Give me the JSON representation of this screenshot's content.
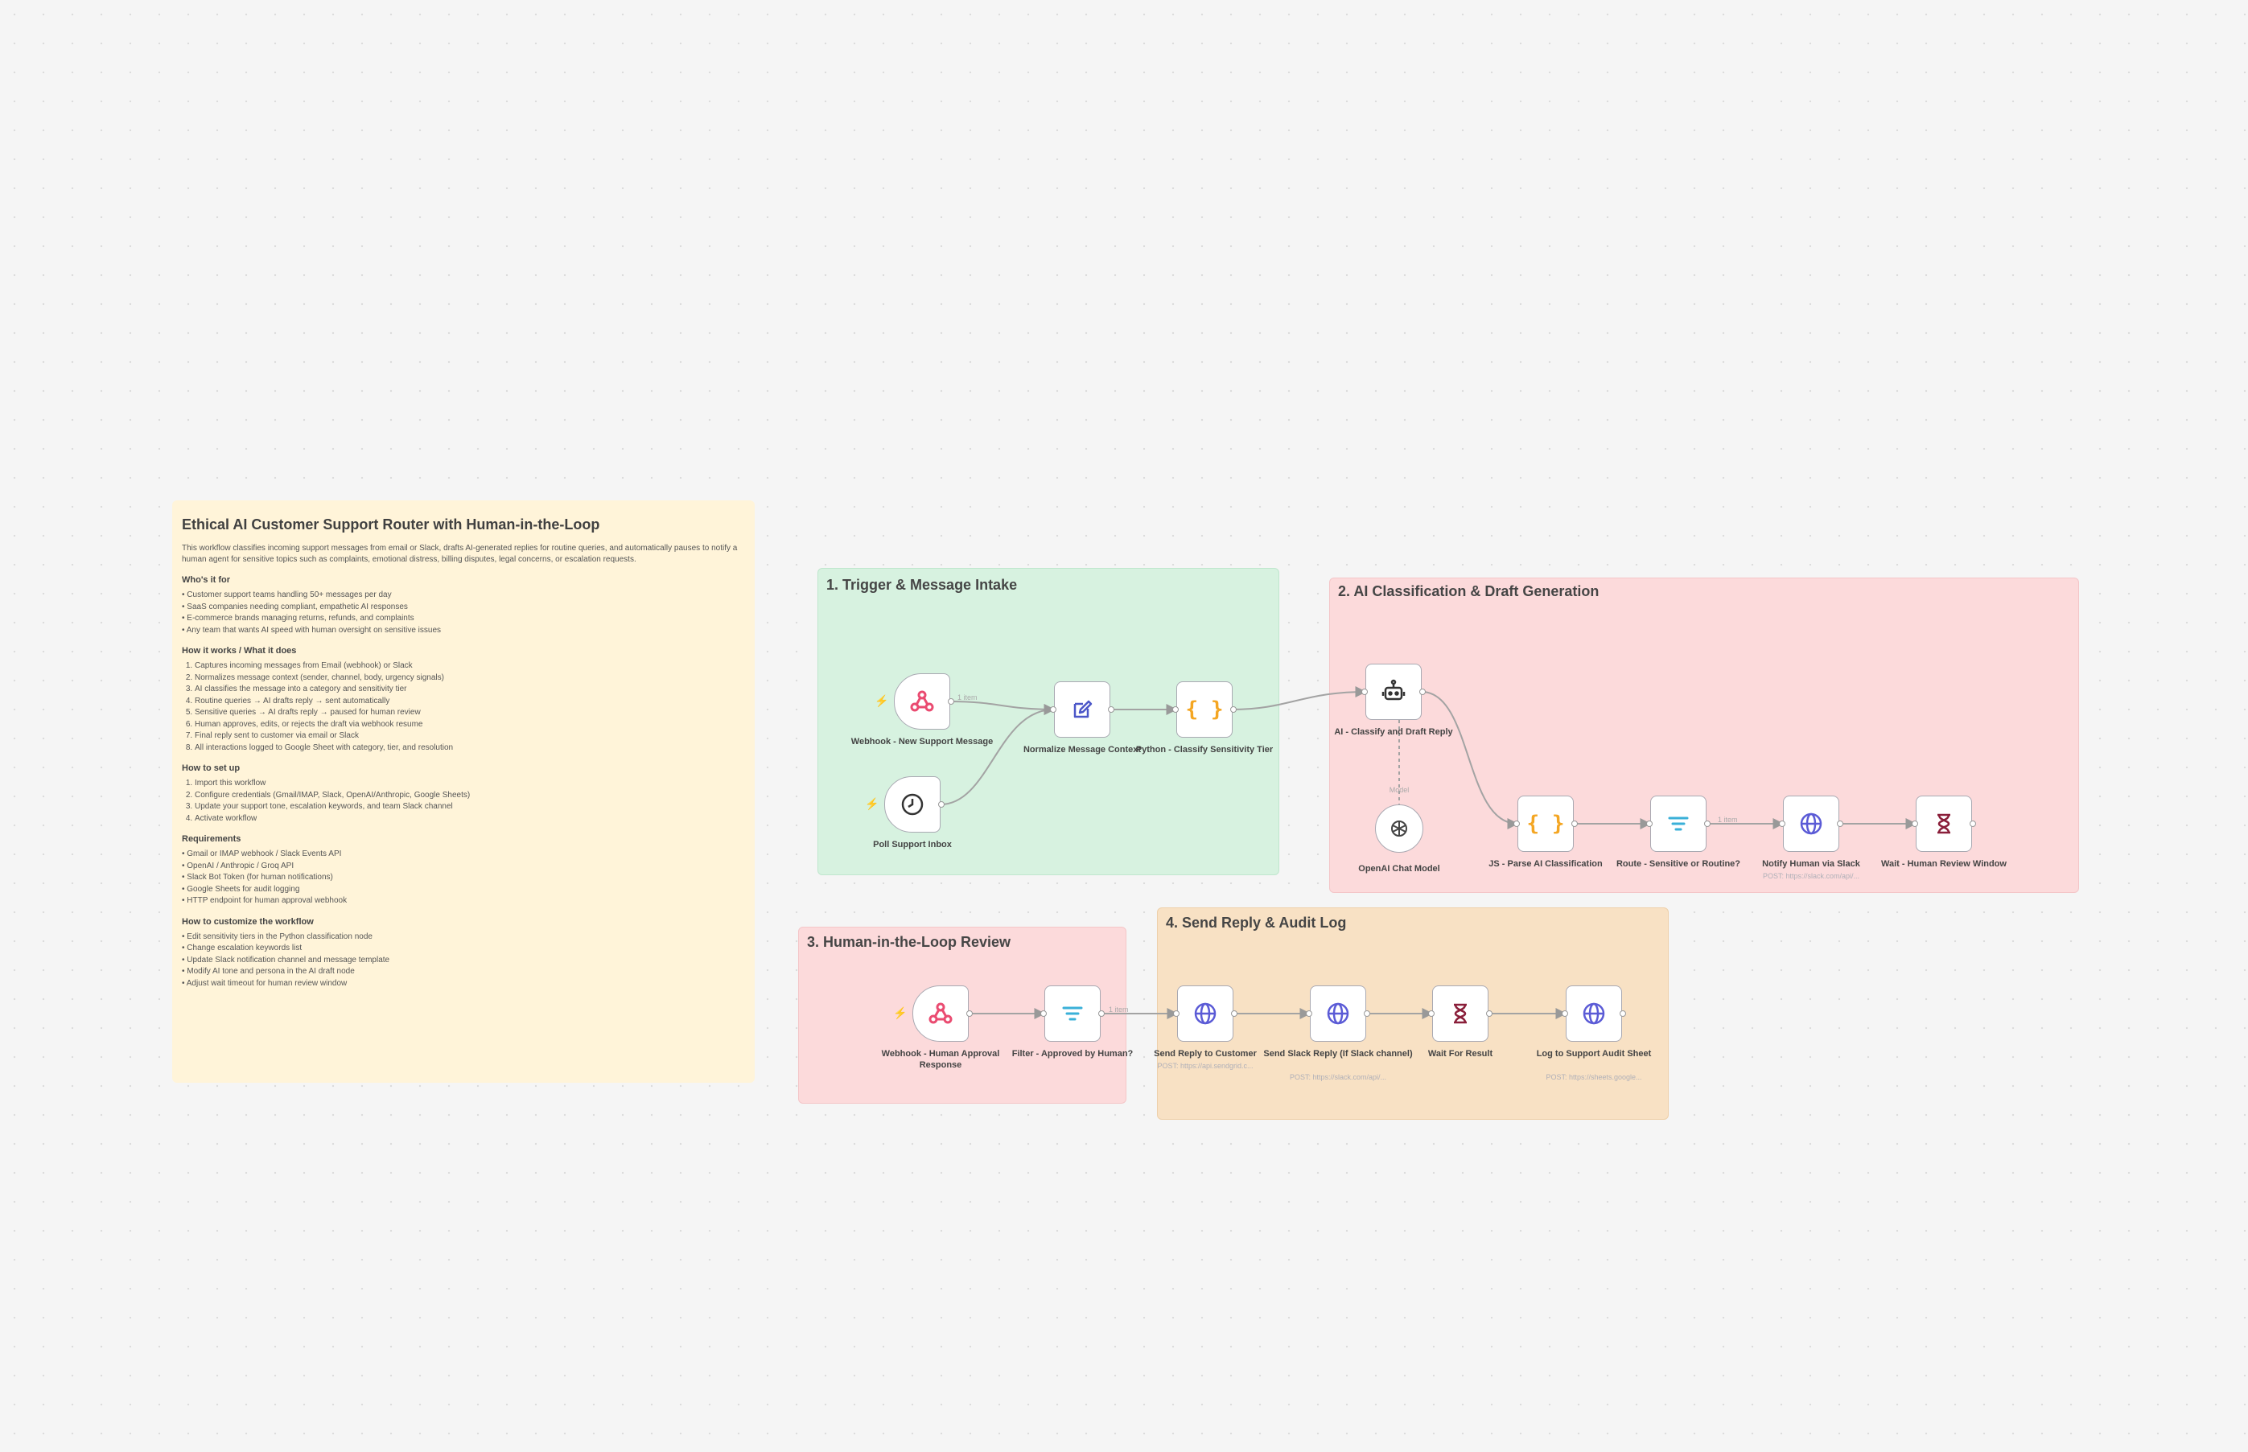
{
  "intro": {
    "title": "Ethical AI Customer Support Router with Human-in-the-Loop",
    "description": "This workflow classifies incoming support messages from email or Slack, drafts AI-generated replies for routine queries, and automatically pauses to notify a human agent for sensitive topics such as complaints, emotional distress, billing disputes, legal concerns, or escalation requests.",
    "who_heading": "Who's it for",
    "who_items": [
      "Customer support teams handling 50+ messages per day",
      "SaaS companies needing compliant, empathetic AI responses",
      "E-commerce brands managing returns, refunds, and complaints",
      "Any team that wants AI speed with human oversight on sensitive issues"
    ],
    "how_heading": "How it works / What it does",
    "how_items": [
      "Captures incoming messages from Email (webhook) or Slack",
      "Normalizes message context (sender, channel, body, urgency signals)",
      "AI classifies the message into a category and sensitivity tier",
      "Routine queries → AI drafts reply → sent automatically",
      "Sensitive queries → AI drafts reply → paused for human review",
      "Human approves, edits, or rejects the draft via webhook resume",
      "Final reply sent to customer via email or Slack",
      "All interactions logged to Google Sheet with category, tier, and resolution"
    ],
    "setup_heading": "How to set up",
    "setup_items": [
      "Import this workflow",
      "Configure credentials (Gmail/IMAP, Slack, OpenAI/Anthropic, Google Sheets)",
      "Update your support tone, escalation keywords, and team Slack channel",
      "Activate workflow"
    ],
    "req_heading": "Requirements",
    "req_items": [
      "Gmail or IMAP webhook / Slack Events API",
      "OpenAI / Anthropic / Groq API",
      "Slack Bot Token (for human notifications)",
      "Google Sheets for audit logging",
      "HTTP endpoint for human approval webhook"
    ],
    "custom_heading": "How to customize the workflow",
    "custom_items": [
      "Edit sensitivity tiers in the Python classification node",
      "Change escalation keywords list",
      "Update Slack notification channel and message template",
      "Modify AI tone and persona in the AI draft node",
      "Adjust wait timeout for human review window"
    ]
  },
  "sections": {
    "s1": "1. Trigger & Message Intake",
    "s2": "2. AI Classification & Draft Generation",
    "s3": "3. Human-in-the-Loop Review",
    "s4": "4. Send Reply & Audit Log"
  },
  "nodes": {
    "webhook_new": {
      "label": "Webhook - New Support Message",
      "icon": "webhook-icon"
    },
    "poll_inbox": {
      "label": "Poll Support Inbox",
      "icon": "clock-icon"
    },
    "normalize": {
      "label": "Normalize Message Context",
      "icon": "edit-icon"
    },
    "python_classify": {
      "label": "Python - Classify Sensitivity Tier",
      "icon": "code-icon"
    },
    "ai_classify": {
      "label": "AI - Classify and Draft Reply",
      "icon": "robot-icon"
    },
    "openai_model": {
      "label": "OpenAI Chat Model",
      "tag": "Model",
      "icon": "openai-icon"
    },
    "js_parse": {
      "label": "JS - Parse AI Classification",
      "icon": "code-icon"
    },
    "route": {
      "label": "Route - Sensitive or Routine?",
      "icon": "filter-icon"
    },
    "notify_slack": {
      "label": "Notify Human via Slack",
      "sub": "POST: https://slack.com/api/...",
      "icon": "globe-icon"
    },
    "wait_review": {
      "label": "Wait - Human Review Window",
      "icon": "hourglass-icon"
    },
    "webhook_approval": {
      "label": "Webhook - Human Approval Response",
      "icon": "webhook-icon"
    },
    "filter_approved": {
      "label": "Filter - Approved by Human?",
      "icon": "filter-icon"
    },
    "send_customer": {
      "label": "Send Reply to Customer",
      "sub": "POST: https://api.sendgrid.c...",
      "icon": "globe-icon"
    },
    "send_slack": {
      "label": "Send Slack Reply (If Slack channel)",
      "sub": "POST: https://slack.com/api/...",
      "icon": "globe-icon"
    },
    "wait_result": {
      "label": "Wait For Result",
      "icon": "hourglass-icon"
    },
    "log_sheet": {
      "label": "Log to Support Audit Sheet",
      "sub": "POST: https://sheets.google...",
      "icon": "globe-icon"
    }
  },
  "edge_labels": {
    "e_webhook_normalize": "1 item",
    "e_route_notify": "1 item",
    "e_filter_send": "1 item"
  },
  "colors": {
    "canvas_bg": "#f5f5f5",
    "intro_note": "#fff4d9",
    "section_green": "#d7f2e0",
    "section_pink": "#fcdadb",
    "section_orange": "#f8e1c4",
    "webhook_pink": "#ea4b71",
    "code_orange": "#f4a623",
    "globe_blue": "#5b5bd6",
    "hourglass_maroon": "#8a1f3a",
    "trigger_bolt": "#ff6d5a"
  }
}
